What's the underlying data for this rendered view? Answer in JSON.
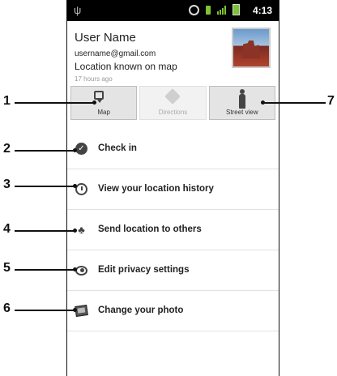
{
  "status_bar": {
    "time": "4:13"
  },
  "profile": {
    "user_name": "User Name",
    "email": "username@gmail.com",
    "location_status": "Location known on map",
    "last_update": "17 hours ago"
  },
  "actions": [
    {
      "label": "Map",
      "icon": "map-icon",
      "enabled": true
    },
    {
      "label": "Directions",
      "icon": "directions-icon",
      "enabled": false
    },
    {
      "label": "Street view",
      "icon": "street-view-icon",
      "enabled": true
    }
  ],
  "menu": [
    {
      "label": "Check in",
      "icon": "check-in-icon"
    },
    {
      "label": "View your location history",
      "icon": "history-icon"
    },
    {
      "label": "Send location to others",
      "icon": "send-location-icon"
    },
    {
      "label": "Edit privacy settings",
      "icon": "eye-icon"
    },
    {
      "label": "Change your photo",
      "icon": "photo-icon"
    }
  ],
  "callouts": [
    "1",
    "2",
    "3",
    "4",
    "5",
    "6",
    "7"
  ]
}
